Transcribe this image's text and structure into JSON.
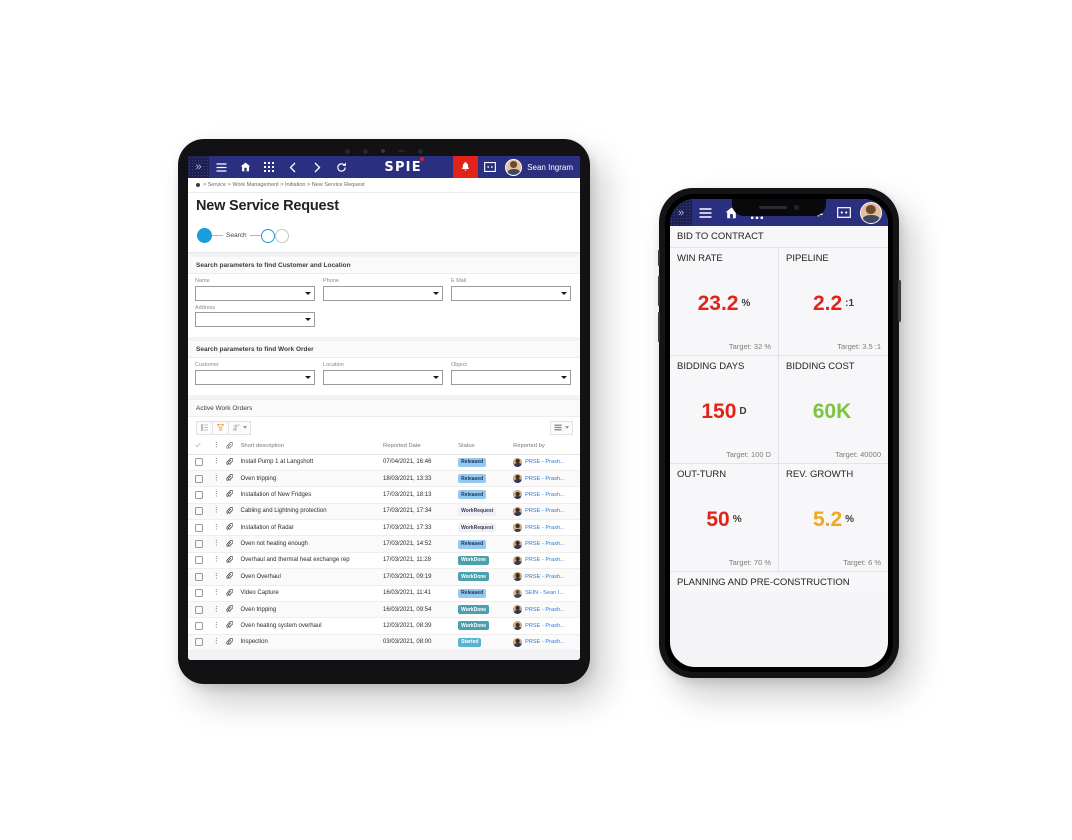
{
  "tablet": {
    "topbar": {
      "expand_icon": "chevron-double-right-icon",
      "menu_icon": "hamburger-menu-icon",
      "home_icon": "home-icon",
      "apps_icon": "grid-apps-icon",
      "back_icon": "chevron-left-icon",
      "forward_icon": "chevron-right-icon",
      "refresh_icon": "refresh-icon",
      "logo_text": "SPIE",
      "bell_icon": "bell-notification-icon",
      "message_icon": "message-icon",
      "user_name": "Sean Ingram"
    },
    "breadcrumb": {
      "home_icon": "home-dot-icon",
      "text": "> Service > Work Management > Initiation > New Service Request"
    },
    "page_title": "New Service Request",
    "stepper": {
      "step_label": "Search"
    },
    "panel_customer": {
      "heading": "Search parameters to find Customer and Location",
      "fields": [
        {
          "label": "Name",
          "value": ""
        },
        {
          "label": "Phone",
          "value": ""
        },
        {
          "label": "E Mail",
          "value": ""
        },
        {
          "label": "Address",
          "value": ""
        }
      ]
    },
    "panel_workorder": {
      "heading": "Search parameters to find Work Order",
      "fields": [
        {
          "label": "Customer",
          "value": ""
        },
        {
          "label": "Location",
          "value": ""
        },
        {
          "label": "Object",
          "value": ""
        }
      ]
    },
    "table_section": {
      "heading": "Active Work Orders",
      "toolbar": {
        "list_icon": "list-view-icon",
        "filter_icon": "filter-funnel-icon",
        "chart_icon": "chart-icon",
        "chart_caret_icon": "chevron-down-icon",
        "view_icon": "table-view-icon",
        "view_caret_icon": "chevron-down-icon"
      },
      "columns": [
        "",
        "",
        "",
        "Short description",
        "Reported Date",
        "Status",
        "Reported by"
      ],
      "rows": [
        {
          "desc": "Install Pump 1 at Langshott",
          "date": "07/04/2021, 16:46",
          "status": "Released",
          "status_kind": "released",
          "by": "PRSE - Prash...",
          "avatar": "dark"
        },
        {
          "desc": "Oven tripping",
          "date": "18/03/2021, 13:33",
          "status": "Released",
          "status_kind": "released",
          "by": "PRSE - Prash...",
          "avatar": "dark"
        },
        {
          "desc": "Installation of New Fridges",
          "date": "17/03/2021, 18:13",
          "status": "Released",
          "status_kind": "released",
          "by": "PRSE - Prash...",
          "avatar": "dark"
        },
        {
          "desc": "Cabling and Lightning protection",
          "date": "17/03/2021, 17:34",
          "status": "WorkRequest",
          "status_kind": "workrequest",
          "by": "PRSE - Prash...",
          "avatar": "dark"
        },
        {
          "desc": "Installation of Radar",
          "date": "17/03/2021, 17:33",
          "status": "WorkRequest",
          "status_kind": "workrequest",
          "by": "PRSE - Prash...",
          "avatar": "dark"
        },
        {
          "desc": "Oven not heating enough",
          "date": "17/03/2021, 14:52",
          "status": "Released",
          "status_kind": "released",
          "by": "PRSE - Prash...",
          "avatar": "dark"
        },
        {
          "desc": "Overhaul and thermal heat exchange rep",
          "date": "17/03/2021, 11:28",
          "status": "WorkDone",
          "status_kind": "workdone",
          "by": "PRSE - Prash...",
          "avatar": "dark"
        },
        {
          "desc": "Oven Overhaul",
          "date": "17/03/2021, 09:19",
          "status": "WorkDone",
          "status_kind": "workdone",
          "by": "PRSE - Prash...",
          "avatar": "dark"
        },
        {
          "desc": "Video Capture",
          "date": "16/03/2021, 11:41",
          "status": "Released",
          "status_kind": "released",
          "by": "SEIN - Sean I...",
          "avatar": "light"
        },
        {
          "desc": "Oven tripping",
          "date": "16/03/2021, 09:54",
          "status": "WorkDone",
          "status_kind": "workdone",
          "by": "PRSE - Prash...",
          "avatar": "dark"
        },
        {
          "desc": "Oven heating system overhaul",
          "date": "12/03/2021, 08:39",
          "status": "WorkDone",
          "status_kind": "workdone",
          "by": "PRSE - Prash...",
          "avatar": "dark"
        },
        {
          "desc": "Inspection",
          "date": "03/03/2021, 08:00",
          "status": "Started",
          "status_kind": "started",
          "by": "PRSE - Prash...",
          "avatar": "dark"
        }
      ]
    }
  },
  "phone": {
    "topbar": {
      "expand_icon": "chevron-double-right-icon",
      "menu_icon": "hamburger-menu-icon",
      "home_icon": "home-icon",
      "apps_icon": "grid-apps-icon",
      "bell_icon": "bell-notification-icon",
      "message_icon": "message-icon"
    },
    "section_title": "BID TO CONTRACT",
    "kpis": [
      {
        "title": "WIN RATE",
        "value": "23.2",
        "unit": "%",
        "color": "#e2231a",
        "target": "Target: 32 %"
      },
      {
        "title": "PIPELINE",
        "value": "2.2",
        "unit": ":1",
        "color": "#e2231a",
        "target": "Target: 3.5 :1"
      },
      {
        "title": "BIDDING DAYS",
        "value": "150",
        "unit": "D",
        "color": "#e2231a",
        "target": "Target: 100 D"
      },
      {
        "title": "BIDDING COST",
        "value": "60K",
        "unit": "",
        "color": "#7fc241",
        "target": "Target: 40000"
      },
      {
        "title": "OUT-TURN",
        "value": "50",
        "unit": "%",
        "color": "#e2231a",
        "target": "Target: 70 %"
      },
      {
        "title": "REV. GROWTH",
        "value": "5.2",
        "unit": "%",
        "color": "#f0a81e",
        "target": "Target: 6 %"
      }
    ],
    "section_title_2": "PLANNING AND PRE-CONSTRUCTION"
  }
}
